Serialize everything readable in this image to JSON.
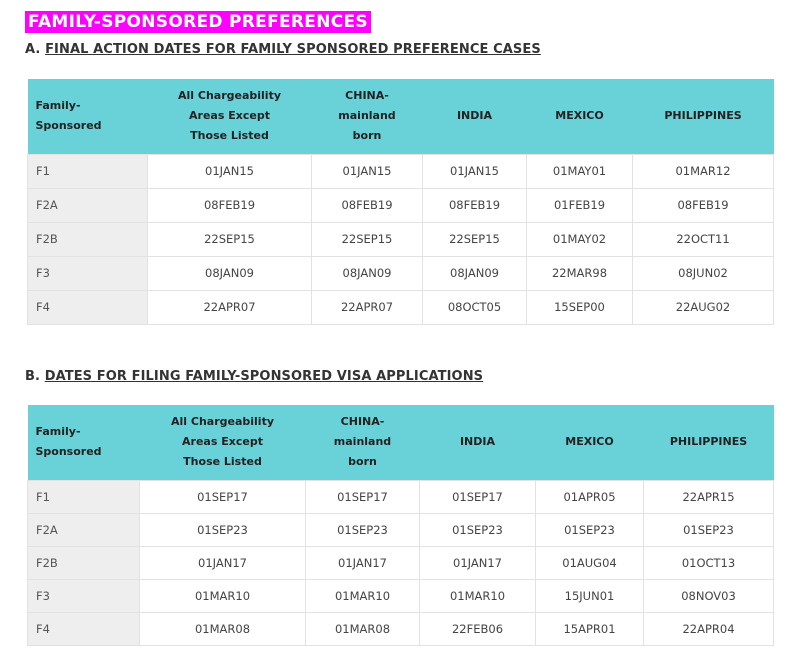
{
  "title": "FAMILY-SPONSORED PREFERENCES",
  "section_a": {
    "prefix": "A. ",
    "heading": "FINAL ACTION DATES FOR FAMILY SPONSORED PREFERENCE CASES",
    "headers": {
      "family": [
        "Family-",
        "Sponsored"
      ],
      "all": [
        "All Chargeability",
        "Areas Except",
        "Those Listed"
      ],
      "china": [
        "CHINA-",
        "mainland",
        "born"
      ],
      "india": "INDIA",
      "mexico": "MEXICO",
      "philippines": "PHILIPPINES"
    },
    "rows": [
      {
        "cat": "F1",
        "all": "01JAN15",
        "china": "01JAN15",
        "india": "01JAN15",
        "mexico": "01MAY01",
        "philippines": "01MAR12"
      },
      {
        "cat": "F2A",
        "all": "08FEB19",
        "china": "08FEB19",
        "india": "08FEB19",
        "mexico": "01FEB19",
        "philippines": "08FEB19"
      },
      {
        "cat": "F2B",
        "all": "22SEP15",
        "china": "22SEP15",
        "india": "22SEP15",
        "mexico": "01MAY02",
        "philippines": "22OCT11"
      },
      {
        "cat": "F3",
        "all": "08JAN09",
        "china": "08JAN09",
        "india": "08JAN09",
        "mexico": "22MAR98",
        "philippines": "08JUN02"
      },
      {
        "cat": "F4",
        "all": "22APR07",
        "china": "22APR07",
        "india": "08OCT05",
        "mexico": "15SEP00",
        "philippines": "22AUG02"
      }
    ]
  },
  "section_b": {
    "prefix": "B. ",
    "heading": "DATES FOR FILING FAMILY-SPONSORED VISA APPLICATIONS",
    "headers": {
      "family": [
        "Family-",
        "Sponsored"
      ],
      "all": [
        "All Chargeability",
        "Areas Except",
        "Those Listed"
      ],
      "china": [
        "CHINA-",
        "mainland",
        "born"
      ],
      "india": "INDIA",
      "mexico": "MEXICO",
      "philippines": "PHILIPPINES"
    },
    "rows": [
      {
        "cat": "F1",
        "all": "01SEP17",
        "china": "01SEP17",
        "india": "01SEP17",
        "mexico": "01APR05",
        "philippines": "22APR15"
      },
      {
        "cat": "F2A",
        "all": "01SEP23",
        "china": "01SEP23",
        "india": "01SEP23",
        "mexico": "01SEP23",
        "philippines": "01SEP23"
      },
      {
        "cat": "F2B",
        "all": "01JAN17",
        "china": "01JAN17",
        "india": "01JAN17",
        "mexico": "01AUG04",
        "philippines": "01OCT13"
      },
      {
        "cat": "F3",
        "all": "01MAR10",
        "china": "01MAR10",
        "india": "01MAR10",
        "mexico": "15JUN01",
        "philippines": "08NOV03"
      },
      {
        "cat": "F4",
        "all": "01MAR08",
        "china": "01MAR08",
        "india": "22FEB06",
        "mexico": "15APR01",
        "philippines": "22APR04"
      }
    ]
  },
  "colors": {
    "title_background": "#ff00ff",
    "header_background": "#68d2d8",
    "category_cell_background": "#eeeeee"
  }
}
